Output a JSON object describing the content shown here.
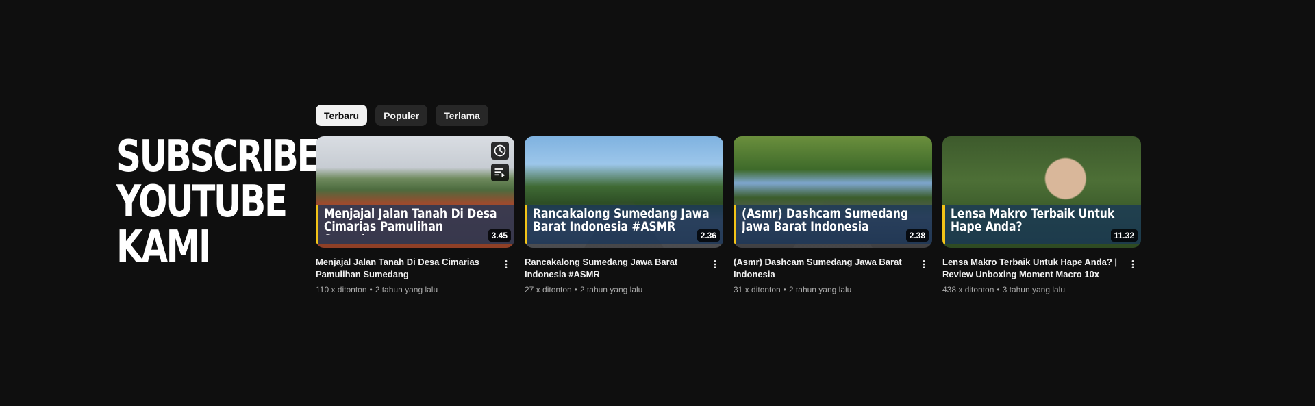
{
  "promo": {
    "lines": [
      "SUBSCRIBE",
      "YOUTUBE",
      "KAMI"
    ]
  },
  "chips": [
    {
      "label": "Terbaru",
      "active": true
    },
    {
      "label": "Populer",
      "active": false
    },
    {
      "label": "Terlama",
      "active": false
    }
  ],
  "videos": [
    {
      "thumb_caption": "Menjajal Jalan Tanah Di Desa Cimarias Pamulihan Sumedang",
      "duration": "3.45",
      "title": "Menjajal Jalan Tanah Di Desa Cimarias Pamulihan Sumedang",
      "views": "110 x ditonton",
      "age": "2 tahun yang lalu"
    },
    {
      "thumb_caption": "Rancakalong Sumedang Jawa Barat Indonesia #ASMR",
      "duration": "2.36",
      "title": "Rancakalong Sumedang Jawa Barat Indonesia #ASMR",
      "views": "27 x ditonton",
      "age": "2 tahun yang lalu"
    },
    {
      "thumb_caption": "(Asmr) Dashcam Sumedang Jawa Barat Indonesia",
      "duration": "2.38",
      "title": "(Asmr) Dashcam Sumedang Jawa Barat Indonesia",
      "views": "31 x ditonton",
      "age": "2 tahun yang lalu"
    },
    {
      "thumb_caption": "Lensa Makro Terbaik Untuk Hape Anda?",
      "duration": "11.32",
      "title": "Lensa Makro Terbaik Untuk Hape Anda? | Review Unboxing Moment Macro 10x",
      "views": "438 x ditonton",
      "age": "3 tahun yang lalu"
    }
  ],
  "separator": "•",
  "icons": {
    "watch_later": "clock-icon",
    "add_to_queue": "queue-icon",
    "more": "more-vert-icon"
  },
  "colors": {
    "background": "#0f0f0f",
    "chip_active": "#f1f1f1",
    "chip_inactive": "#272727",
    "caption_accent": "#f2c318"
  }
}
